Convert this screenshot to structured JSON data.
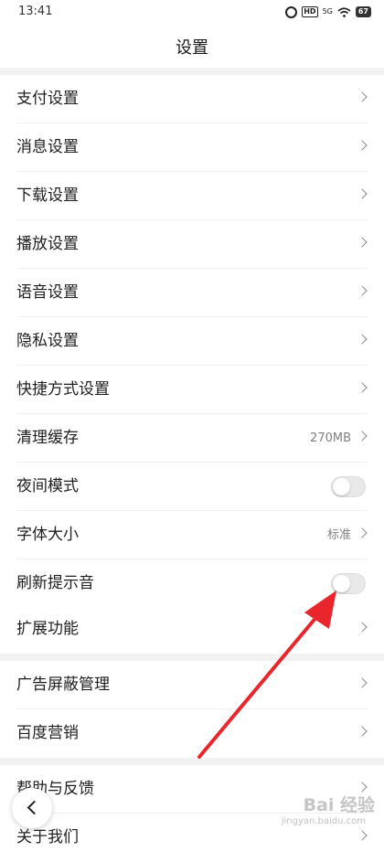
{
  "status_bar": {
    "time": "13:41",
    "icons": [
      "alarm-icon",
      "hd-icon",
      "signal-5g-icon",
      "wifi-icon",
      "battery-icon"
    ],
    "hd": "HD",
    "net": "5G",
    "battery": "67"
  },
  "header": {
    "title": "设置"
  },
  "sections": [
    {
      "items": [
        {
          "label": "支付设置",
          "control": "chevron"
        },
        {
          "label": "消息设置",
          "control": "chevron"
        },
        {
          "label": "下载设置",
          "control": "chevron"
        },
        {
          "label": "播放设置",
          "control": "chevron"
        },
        {
          "label": "语音设置",
          "control": "chevron"
        },
        {
          "label": "隐私设置",
          "control": "chevron"
        },
        {
          "label": "快捷方式设置",
          "control": "chevron"
        },
        {
          "label": "清理缓存",
          "control": "value",
          "value": "270MB"
        },
        {
          "label": "夜间模式",
          "control": "toggle",
          "on": false
        },
        {
          "label": "字体大小",
          "control": "value-chevron",
          "value": "标准"
        },
        {
          "label": "刷新提示音",
          "control": "toggle",
          "on": false
        },
        {
          "label": "扩展功能",
          "control": "chevron"
        }
      ]
    },
    {
      "items": [
        {
          "label": "广告屏蔽管理",
          "control": "chevron"
        },
        {
          "label": "百度营销",
          "control": "chevron"
        }
      ]
    },
    {
      "items": [
        {
          "label": "帮助与反馈",
          "control": "chevron"
        },
        {
          "label": "关于我们",
          "control": "chevron"
        }
      ]
    }
  ],
  "annotation": {
    "type": "red-arrow",
    "color": "#e8262b",
    "points_to": "刷新提示音"
  },
  "watermark": {
    "text": "Bai 经验",
    "sub": "jingyan.baidu.com"
  },
  "colors": {
    "toggle_off": "#e9e9e9",
    "section_gap": "#f2f2f2",
    "text": "#1f1f1f",
    "secondary": "#808080"
  }
}
